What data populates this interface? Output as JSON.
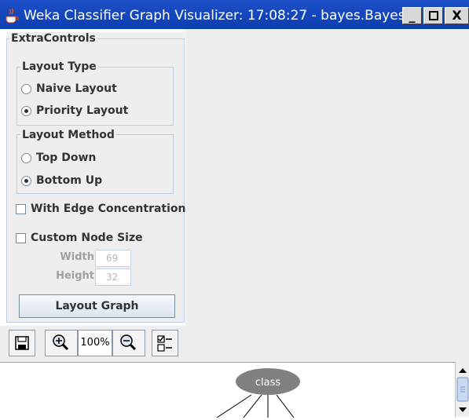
{
  "window": {
    "title": "Weka Classifier Graph Visualizer: 17:08:27 - bayes.Bayes...",
    "buttons": {
      "minimize": "_",
      "maximize": "□",
      "close": "X"
    }
  },
  "controls": {
    "title": "ExtraControls",
    "layout_type": {
      "title": "Layout Type",
      "options": [
        {
          "label": "Naive Layout",
          "selected": false
        },
        {
          "label": "Priority Layout",
          "selected": true
        }
      ]
    },
    "layout_method": {
      "title": "Layout Method",
      "options": [
        {
          "label": "Top Down",
          "selected": false
        },
        {
          "label": "Bottom Up",
          "selected": true
        }
      ]
    },
    "edge_concentration": {
      "label": "With Edge Concentration",
      "checked": false
    },
    "custom_node_size": {
      "label": "Custom Node Size",
      "checked": false
    },
    "width": {
      "label": "Width",
      "value": "69"
    },
    "height": {
      "label": "Height",
      "value": "32"
    },
    "layout_button": "Layout Graph"
  },
  "toolbar": {
    "zoom_value": "100%",
    "icons": [
      "save-icon",
      "zoom-in-icon",
      "zoom-out-icon",
      "extra-controls-icon"
    ]
  },
  "graph": {
    "nodes": [
      {
        "label": "class"
      }
    ]
  },
  "colors": {
    "titlebar": "#0a3fb0",
    "panel": "#eeeeee",
    "node": "#808080",
    "frame_border": "#b8cfe5"
  }
}
